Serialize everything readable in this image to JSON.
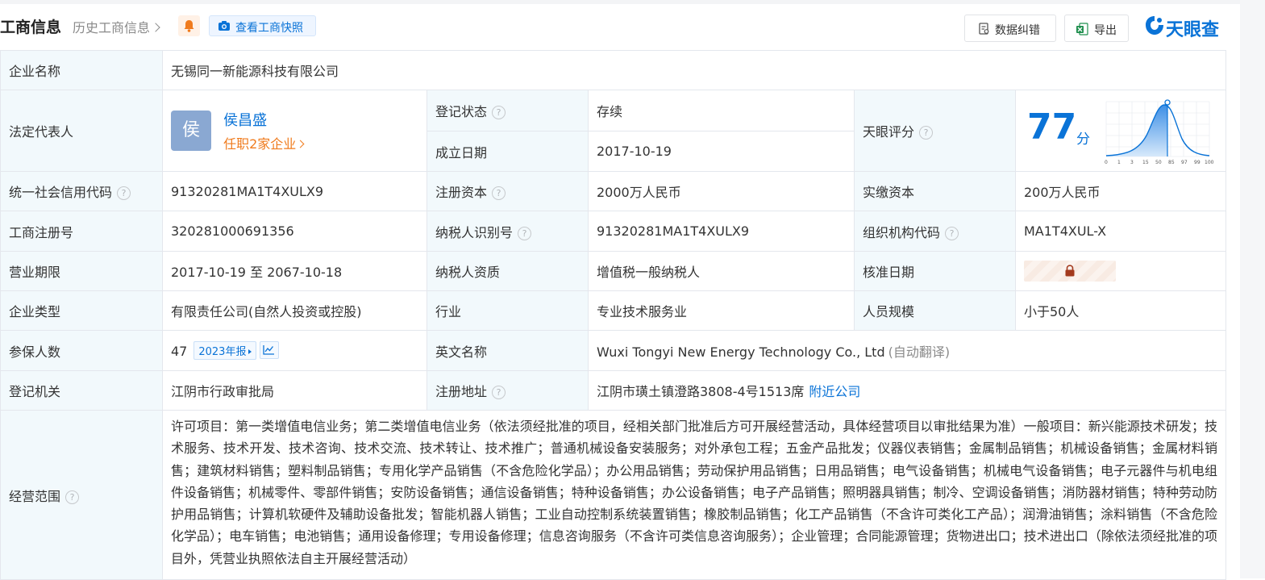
{
  "header": {
    "title": "工商信息",
    "history_link": "历史工商信息",
    "snapshot_button": "查看工商快照",
    "correct_button": "数据纠错",
    "export_button": "导出",
    "logo_text": "天眼查"
  },
  "rows": {
    "company_name": {
      "label": "企业名称",
      "value": "无锡同一新能源科技有限公司"
    },
    "legal_rep": {
      "label": "法定代表人",
      "avatar_char": "侯",
      "name": "侯昌盛",
      "positions": "任职2家企业"
    },
    "reg_status": {
      "label": "登记状态",
      "value": "存续"
    },
    "founded": {
      "label": "成立日期",
      "value": "2017-10-19"
    },
    "score": {
      "label": "天眼评分",
      "value": "77",
      "unit": "分",
      "axis_ticks": [
        "0",
        "1",
        "3",
        "15",
        "50",
        "85",
        "97",
        "99",
        "100"
      ],
      "marker_value": 77
    },
    "credit_code": {
      "label": "统一社会信用代码",
      "value": "91320281MA1T4XULX9"
    },
    "reg_capital": {
      "label": "注册资本",
      "value": "2000万人民币"
    },
    "paid_capital": {
      "label": "实缴资本",
      "value": "200万人民币"
    },
    "reg_number": {
      "label": "工商注册号",
      "value": "320281000691356"
    },
    "taxpayer_id": {
      "label": "纳税人识别号",
      "value": "91320281MA1T4XULX9"
    },
    "org_code": {
      "label": "组织机构代码",
      "value": "MA1T4XUL-X"
    },
    "term": {
      "label": "营业期限",
      "value": "2017-10-19 至 2067-10-18"
    },
    "taxpayer_qual": {
      "label": "纳税人资质",
      "value": "增值税一般纳税人"
    },
    "approve_date": {
      "label": "核准日期"
    },
    "company_type": {
      "label": "企业类型",
      "value": "有限责任公司(自然人投资或控股)"
    },
    "industry": {
      "label": "行业",
      "value": "专业技术服务业"
    },
    "staff_size": {
      "label": "人员规模",
      "value": "小于50人"
    },
    "insured": {
      "label": "参保人数",
      "value": "47",
      "report_badge": "2023年报"
    },
    "english_name": {
      "label": "英文名称",
      "value": "Wuxi Tongyi New Energy Technology Co., Ltd",
      "note": "(自动翻译)"
    },
    "authority": {
      "label": "登记机关",
      "value": "江阴市行政审批局"
    },
    "address": {
      "label": "注册地址",
      "value": "江阴市璜土镇澄路3808-4号1513席",
      "link": "附近公司"
    },
    "scope": {
      "label": "经营范围",
      "value": "许可项目：第一类增值电信业务；第二类增值电信业务（依法须经批准的项目，经相关部门批准后方可开展经营活动，具体经营项目以审批结果为准）一般项目：新兴能源技术研发；技术服务、技术开发、技术咨询、技术交流、技术转让、技术推广；普通机械设备安装服务；对外承包工程；五金产品批发；仪器仪表销售；金属制品销售；机械设备销售；金属材料销售；建筑材料销售；塑料制品销售；专用化学产品销售（不含危险化学品）；办公用品销售；劳动保护用品销售；日用品销售；电气设备销售；机械电气设备销售；电子元器件与机电组件设备销售；机械零件、零部件销售；安防设备销售；通信设备销售；特种设备销售；办公设备销售；电子产品销售；照明器具销售；制冷、空调设备销售；消防器材销售；特种劳动防护用品销售；计算机软硬件及辅助设备批发；智能机器人销售；工业自动控制系统装置销售；橡胶制品销售；化工产品销售（不含许可类化工产品）；润滑油销售；涂料销售（不含危险化学品）；电车销售；电池销售；通用设备修理；专用设备修理；信息咨询服务（不含许可类信息咨询服务）；企业管理；合同能源管理；货物进出口；技术进出口（除依法须经批准的项目外，凭营业执照依法自主开展经营活动）"
    }
  },
  "icons": {
    "bell": "bell-icon",
    "camera": "camera-icon",
    "edit": "edit-document-icon",
    "excel": "excel-icon",
    "help": "question-icon",
    "lock": "lock-icon",
    "trend": "trend-chart-icon"
  },
  "colors": {
    "brand_blue": "#0a73d7",
    "label_bg": "#f2f9fc",
    "status_green": "#2ea14d",
    "orange": "#f07b1d"
  }
}
